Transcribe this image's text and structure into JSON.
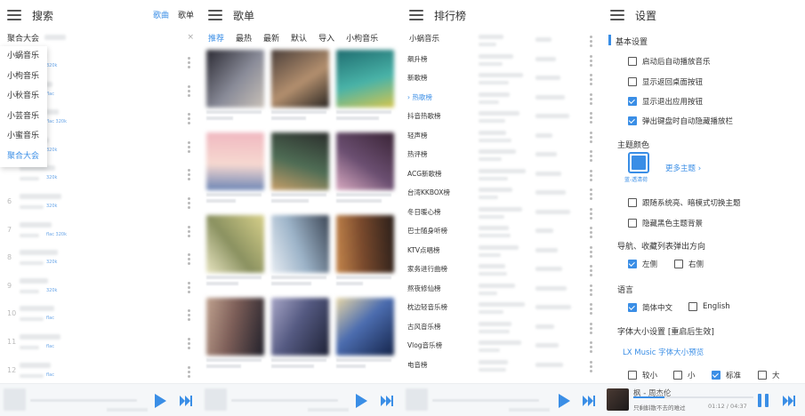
{
  "search_panel": {
    "title": "搜索",
    "tab_song": "歌曲",
    "tab_playlist": "歌单",
    "source_label": "聚合大会",
    "clear_icon": "×",
    "dropdown": [
      "小蜗音乐",
      "小枸音乐",
      "小秋音乐",
      "小芸音乐",
      "小蜜音乐",
      "聚合大会"
    ],
    "rows": [
      {
        "num": "",
        "quality": "320k"
      },
      {
        "num": "",
        "quality": "flac"
      },
      {
        "num": "",
        "quality": "flac 320k"
      },
      {
        "num": "",
        "quality": "320k"
      },
      {
        "num": "",
        "quality": "320k"
      },
      {
        "num": "6",
        "quality": "320k"
      },
      {
        "num": "7",
        "quality": "flac 320k"
      },
      {
        "num": "8",
        "quality": "320k"
      },
      {
        "num": "9",
        "quality": "320k"
      },
      {
        "num": "10",
        "quality": "flac"
      },
      {
        "num": "11",
        "quality": "flac"
      },
      {
        "num": "12",
        "quality": "flac"
      }
    ]
  },
  "playlist_panel": {
    "title": "歌单",
    "tabs": [
      "推荐",
      "最热",
      "最新",
      "默认",
      "导入",
      "小枸音乐"
    ]
  },
  "chart_panel": {
    "title": "排行榜",
    "source": "小蜗音乐",
    "boards": [
      "飙升榜",
      "新歌榜",
      "热歌榜",
      "抖音热歌榜",
      "轻声榜",
      "热评榜",
      "ACG新歌榜",
      "台湾KKBOX榜",
      "冬日暖心榜",
      "巴士随身听榜",
      "KTV点唱榜",
      "家务进行曲榜",
      "熬夜修仙榜",
      "枕边轻音乐榜",
      "古风音乐榜",
      "Vlog音乐榜",
      "电音榜"
    ],
    "selected_board": "热歌榜"
  },
  "settings_panel": {
    "title": "设置",
    "section_basic": "基本设置",
    "opt_autoplay": "启动后自动播放音乐",
    "opt_back_btn": "显示返回桌面按钮",
    "opt_exit_btn": "显示退出应用按钮",
    "opt_hide_bar": "弹出键盘时自动隐藏播放栏",
    "theme_label": "主题颜色",
    "theme_name": "蓝-透清荷",
    "more_theme": "更多主题 ›",
    "opt_follow_system": "跟随系统亮、暗模式切换主题",
    "opt_hide_black_bg": "隐藏黑色主题背景",
    "nav_label": "导航、收藏列表弹出方向",
    "dir_left": "左侧",
    "dir_right": "右侧",
    "lang_label": "语言",
    "lang_zh": "简体中文",
    "lang_en": "English",
    "font_label": "字体大小设置 [重启后生效]",
    "font_preview": "LX Music 字体大小预览",
    "size_xs": "较小",
    "size_s": "小",
    "size_m": "标准",
    "size_l": "大",
    "checked": {
      "autoplay": false,
      "back_btn": false,
      "exit_btn": true,
      "hide_bar": true,
      "follow_system": false,
      "hide_black_bg": false,
      "left": true,
      "right": false,
      "zh": true,
      "en": false,
      "xs": false,
      "s": false,
      "m": true,
      "l": false
    }
  },
  "player": {
    "title": "枫 - 周杰伦",
    "lyric": "只剩斛散不去的难过",
    "time": "01:12 / 04:37",
    "progress": 0.26
  },
  "colors": {
    "accent": "#3a8ee6"
  },
  "icons": {
    "menu": "menu-icon",
    "more": "more-vert-icon",
    "play": "play-icon",
    "next": "skip-next-icon",
    "pause": "pause-icon"
  }
}
